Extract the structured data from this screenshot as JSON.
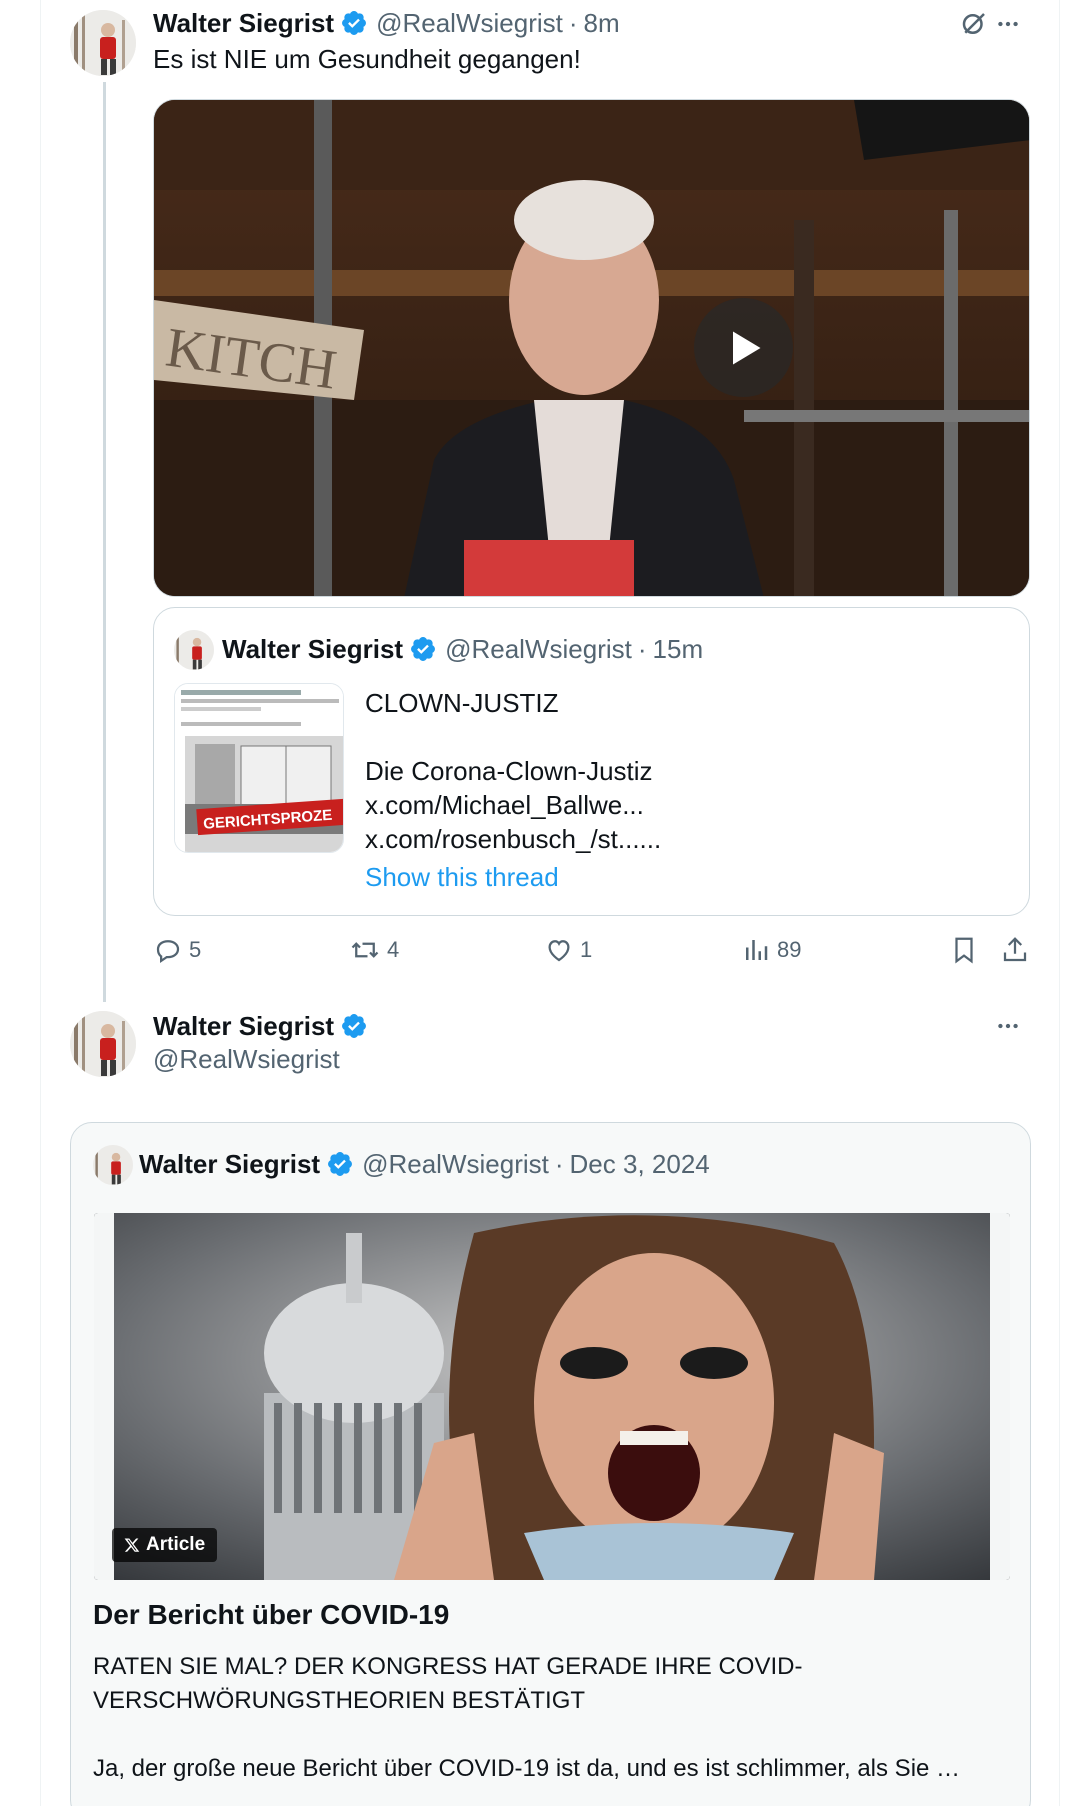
{
  "tweet1": {
    "author_name": "Walter Siegrist",
    "handle": "@RealWsiegrist",
    "separator": "·",
    "time": "8m",
    "text": "Es ist NIE um Gesundheit gegangen!",
    "video_sign_text": "KITCH",
    "quote": {
      "author_name": "Walter Siegrist",
      "handle": "@RealWsiegrist",
      "separator": "·",
      "time": "15m",
      "lines": [
        "CLOWN-JUSTIZ",
        "",
        "Die Corona-Clown-Justiz",
        "x.com/Michael_Ballwe...",
        "x.com/rosenbusch_/st......"
      ],
      "show_thread": "Show this thread",
      "thumb_banner": "GERICHTSPROZE"
    },
    "actions": {
      "replies": "5",
      "retweets": "4",
      "likes": "1",
      "views": "89"
    }
  },
  "tweet2": {
    "author_name": "Walter Siegrist",
    "handle": "@RealWsiegrist",
    "article": {
      "author_name": "Walter Siegrist",
      "handle": "@RealWsiegrist",
      "separator": "·",
      "date": "Dec 3, 2024",
      "badge": "Article",
      "title": "Der Bericht über COVID-19",
      "subtitle": "RATEN SIE MAL? DER KONGRESS HAT GERADE IHRE COVID-VERSCHWÖRUNGSTHEORIEN BESTÄTIGT",
      "excerpt": "Ja, der große neue Bericht über COVID-19 ist da, und es ist schlimmer, als Sie …"
    }
  },
  "colors": {
    "link_blue": "#1d9bf0",
    "verified_blue": "#1d9bf0",
    "muted": "#536471",
    "border": "#cfd9de"
  },
  "icons": [
    "verified-badge-icon",
    "grok-icon",
    "more-icon",
    "play-icon",
    "reply-icon",
    "retweet-icon",
    "like-icon",
    "views-icon",
    "bookmark-icon",
    "share-icon",
    "x-logo-icon"
  ]
}
